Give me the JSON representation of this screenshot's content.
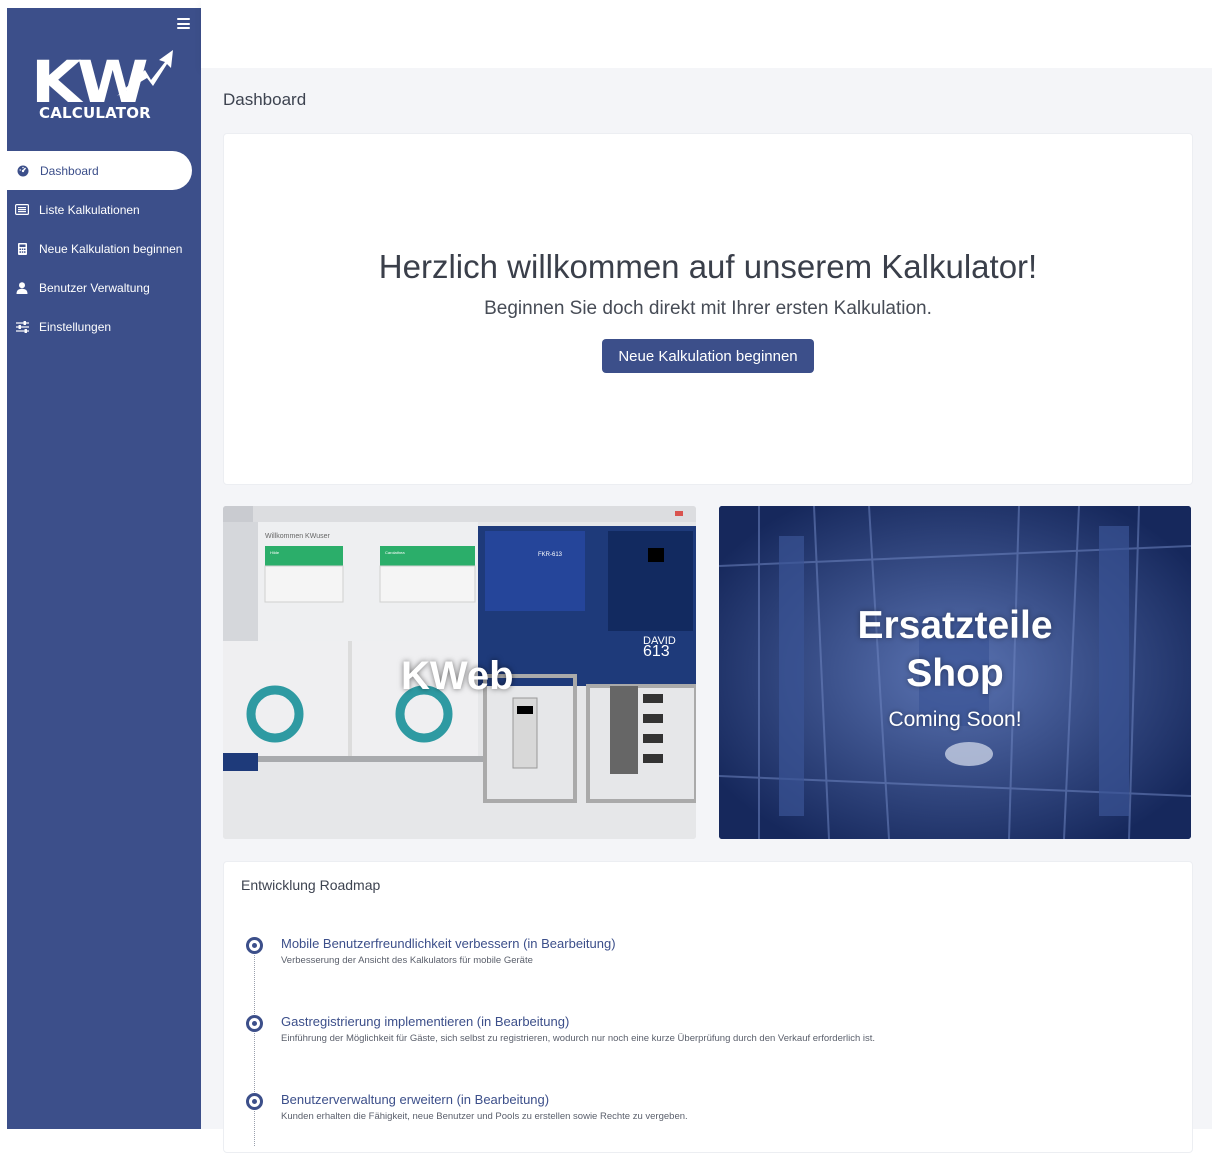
{
  "sidebar": {
    "logo": {
      "main": "KW",
      "sub": "CALCULATOR"
    },
    "items": [
      {
        "label": "Dashboard",
        "icon": "dashboard-icon",
        "active": true
      },
      {
        "label": "Liste Kalkulationen",
        "icon": "list-icon",
        "active": false
      },
      {
        "label": "Neue Kalkulation beginnen",
        "icon": "calculator-icon",
        "active": false
      },
      {
        "label": "Benutzer Verwaltung",
        "icon": "user-icon",
        "active": false
      },
      {
        "label": "Einstellungen",
        "icon": "sliders-icon",
        "active": false
      }
    ]
  },
  "page": {
    "title": "Dashboard"
  },
  "welcome": {
    "title": "Herzlich willkommen auf unserem Kalkulator!",
    "subtitle": "Beginnen Sie doch direkt mit Ihrer ersten Kalkulation.",
    "button": "Neue Kalkulation beginnen"
  },
  "tiles": {
    "kweb": {
      "label": "KWeb",
      "preview": {
        "header": "Willkommen KWuser",
        "card1_title": "Hilde",
        "card2_title": "Carolathea",
        "panel_name": "FKR-613",
        "display_top": "DAVID",
        "display_num": "613"
      }
    },
    "shop": {
      "title_line1": "Ersatzteile",
      "title_line2": "Shop",
      "subtitle": "Coming Soon!"
    }
  },
  "roadmap": {
    "title": "Entwicklung Roadmap",
    "items": [
      {
        "title": "Mobile Benutzerfreundlichkeit verbessern (in Bearbeitung)",
        "desc": "Verbesserung der Ansicht des Kalkulators für mobile Geräte"
      },
      {
        "title": "Gastregistrierung implementieren (in Bearbeitung)",
        "desc": "Einführung der Möglichkeit für Gäste, sich selbst zu registrieren, wodurch nur noch eine kurze Überprüfung durch den Verkauf erforderlich ist."
      },
      {
        "title": "Benutzerverwaltung erweitern (in Bearbeitung)",
        "desc": "Kunden erhalten die Fähigkeit, neue Benutzer und Pools zu erstellen sowie Rechte zu vergeben."
      }
    ]
  },
  "colors": {
    "primary": "#3c4f8a",
    "background": "#f4f5f8",
    "shop_blue": "#1f3470"
  }
}
